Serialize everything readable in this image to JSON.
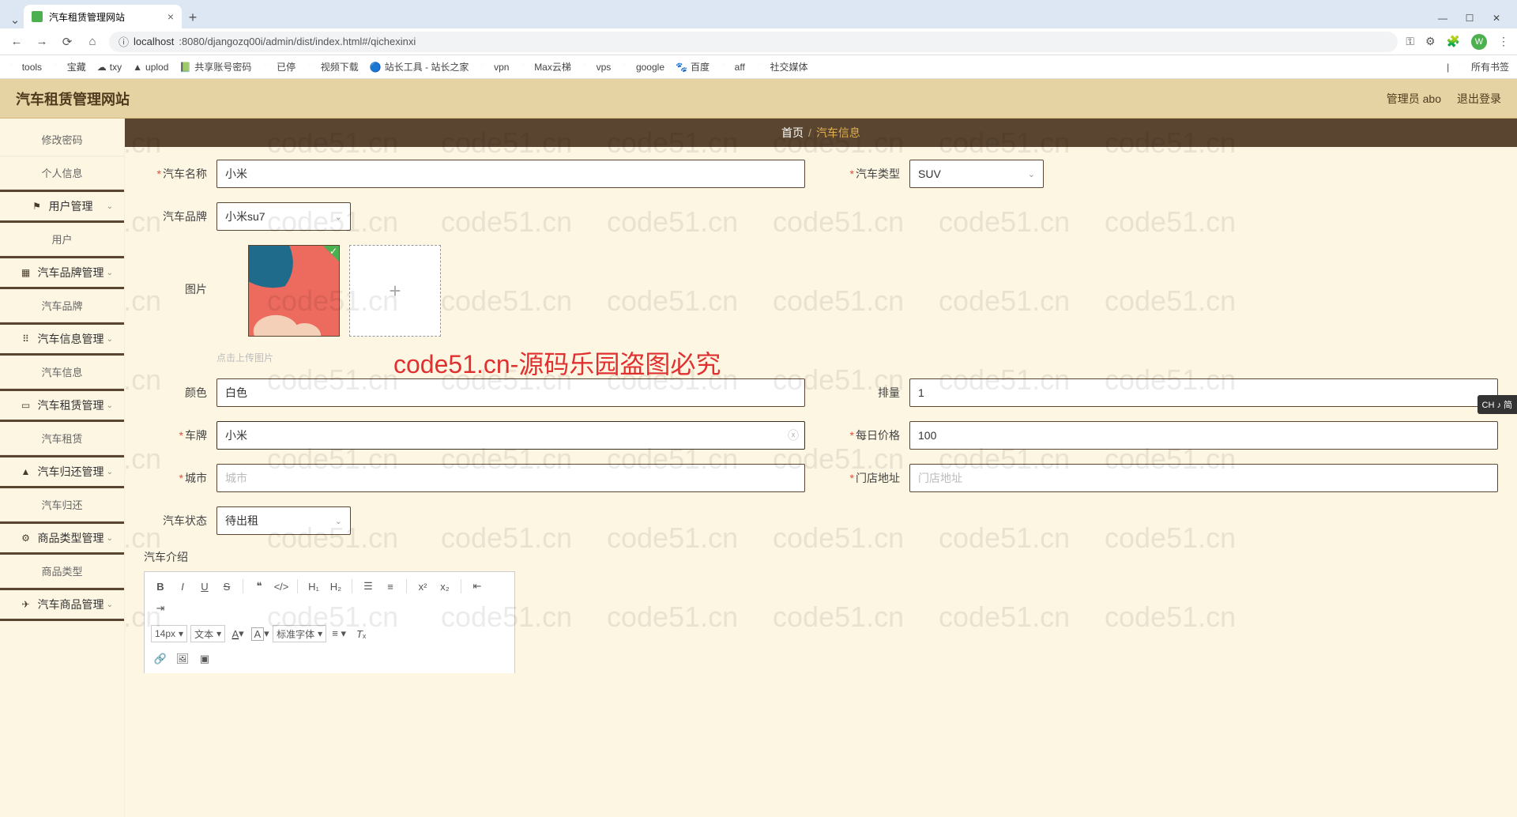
{
  "browser": {
    "tab_title": "汽车租赁管理网站",
    "url_host": "localhost",
    "url_path": ":8080/djangozq00i/admin/dist/index.html#/qichexinxi",
    "window_min": "—",
    "window_max": "☐",
    "window_close": "✕"
  },
  "bookmarks": [
    {
      "label": "tools"
    },
    {
      "label": "宝藏"
    },
    {
      "label": "txy"
    },
    {
      "label": "uplod"
    },
    {
      "label": "共享账号密码"
    },
    {
      "label": "已停"
    },
    {
      "label": "视频下载"
    },
    {
      "label": "站长工具 - 站长之家"
    },
    {
      "label": "vpn"
    },
    {
      "label": "Max云梯"
    },
    {
      "label": "vps"
    },
    {
      "label": "google"
    },
    {
      "label": "百度"
    },
    {
      "label": "aff"
    },
    {
      "label": "社交媒体"
    }
  ],
  "bookmarks_all": "所有书签",
  "header": {
    "title": "汽车租赁管理网站",
    "user": "管理员 abo",
    "logout": "退出登录"
  },
  "sidebar": [
    {
      "label": "修改密码",
      "type": "sub"
    },
    {
      "label": "个人信息",
      "type": "sub"
    },
    {
      "label": "用户管理",
      "type": "group",
      "icon": "⚑",
      "chev": true
    },
    {
      "label": "用户",
      "type": "sub"
    },
    {
      "label": "汽车品牌管理",
      "type": "group",
      "icon": "▦",
      "chev": true
    },
    {
      "label": "汽车品牌",
      "type": "sub"
    },
    {
      "label": "汽车信息管理",
      "type": "group",
      "icon": "⠿",
      "chev": true
    },
    {
      "label": "汽车信息",
      "type": "sub"
    },
    {
      "label": "汽车租赁管理",
      "type": "group",
      "icon": "▭",
      "chev": true
    },
    {
      "label": "汽车租赁",
      "type": "sub"
    },
    {
      "label": "汽车归还管理",
      "type": "group",
      "icon": "▲",
      "chev": true
    },
    {
      "label": "汽车归还",
      "type": "sub"
    },
    {
      "label": "商品类型管理",
      "type": "group",
      "icon": "⚙",
      "chev": true
    },
    {
      "label": "商品类型",
      "type": "sub"
    },
    {
      "label": "汽车商品管理",
      "type": "group",
      "icon": "✈",
      "chev": true
    }
  ],
  "breadcrumb": {
    "home": "首页",
    "sep": "/",
    "current": "汽车信息"
  },
  "form": {
    "car_name_label": "汽车名称",
    "car_name_value": "小米",
    "car_type_label": "汽车类型",
    "car_type_value": "SUV",
    "brand_label": "汽车品牌",
    "brand_value": "小米su7",
    "image_label": "图片",
    "upload_hint": "点击上传图片",
    "color_label": "颜色",
    "color_value": "白色",
    "displacement_label": "排量",
    "displacement_value": "1",
    "plate_label": "车牌",
    "plate_value": "小米",
    "daily_price_label": "每日价格",
    "daily_price_value": "100",
    "city_label": "城市",
    "city_placeholder": "城市",
    "store_label": "门店地址",
    "store_placeholder": "门店地址",
    "status_label": "汽车状态",
    "status_value": "待出租",
    "intro_label": "汽车介绍"
  },
  "editor": {
    "font_size": "14px",
    "style1": "文本",
    "style2": "标准字体"
  },
  "watermark": "code51.cn-源码乐园盗图必究",
  "wm_small": "code51.cn",
  "ime": "CH ♪ 简"
}
